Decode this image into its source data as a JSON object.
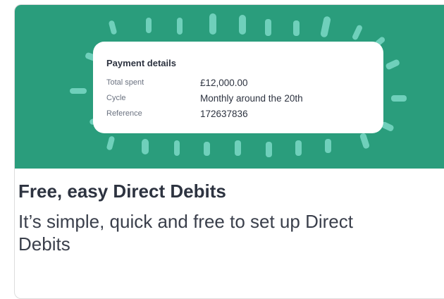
{
  "card": {
    "title": "Free, easy Direct Debits",
    "description": "It’s simple, quick and free to set up Direct Debits"
  },
  "payment_details": {
    "heading": "Payment details",
    "rows": [
      {
        "label": "Total spent",
        "value": "£12,000.00"
      },
      {
        "label": "Cycle",
        "value": "Monthly around the 20th"
      },
      {
        "label": "Reference",
        "value": "172637836"
      }
    ]
  },
  "colors": {
    "hero_background": "#2a9d7c",
    "ray_color": "#6fd0bb",
    "text_dark": "#2d3340"
  }
}
